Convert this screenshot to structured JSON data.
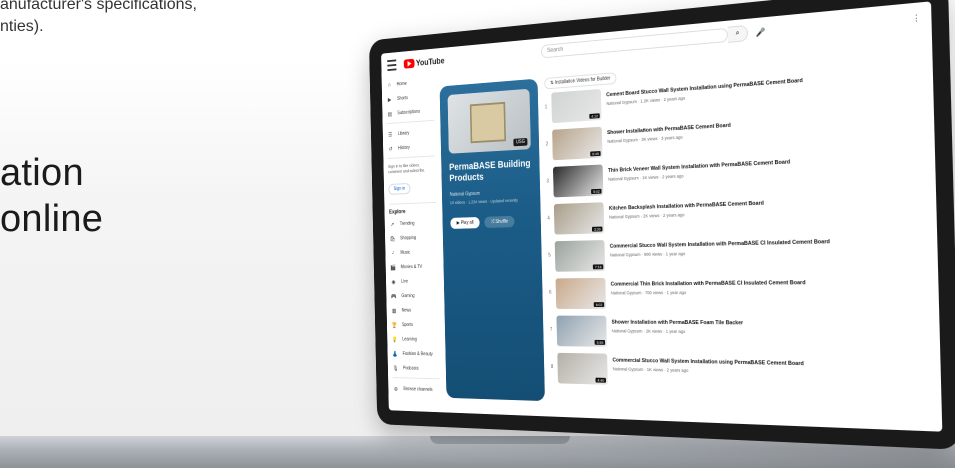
{
  "intro": {
    "line1": "anufacturer's specifications,",
    "line2": "nties)."
  },
  "headline": {
    "line1": "ation",
    "line2": "online"
  },
  "youtube": {
    "logo_text": "YouTube",
    "search_placeholder": "Search",
    "sidebar": {
      "items": [
        {
          "icon": "⌂",
          "label": "Home"
        },
        {
          "icon": "▶",
          "label": "Shorts"
        },
        {
          "icon": "▤",
          "label": "Subscriptions"
        },
        {
          "icon": "☰",
          "label": "Library"
        },
        {
          "icon": "↺",
          "label": "History"
        }
      ],
      "note": "Sign in to like videos, comment and subscribe.",
      "sign_in": "Sign in",
      "explore_title": "Explore",
      "explore_items": [
        {
          "icon": "↗",
          "label": "Trending"
        },
        {
          "icon": "🛍",
          "label": "Shopping"
        },
        {
          "icon": "♪",
          "label": "Music"
        },
        {
          "icon": "🎬",
          "label": "Movies & TV"
        },
        {
          "icon": "◉",
          "label": "Live"
        },
        {
          "icon": "🎮",
          "label": "Gaming"
        },
        {
          "icon": "▦",
          "label": "News"
        },
        {
          "icon": "🏆",
          "label": "Sports"
        },
        {
          "icon": "💡",
          "label": "Learning"
        },
        {
          "icon": "👗",
          "label": "Fashion & Beauty"
        },
        {
          "icon": "🎙",
          "label": "Podcasts"
        }
      ],
      "browse": "Browse channels"
    },
    "playlist": {
      "title": "PermaBASE Building Products",
      "owner": "National Gypsum",
      "meta": "10 videos · 1,234 views · Updated recently",
      "thumb_badge": "USG",
      "play_all": "▶ Play all",
      "shuffle": "⤮ Shuffle"
    },
    "filter_label": "⇅ Installation Videos for Builder",
    "videos": [
      {
        "num": "1",
        "title": "Cement Board Stucco Wall System Installation using PermaBASE Cement Board",
        "meta": "National Gypsum · 1.2K views · 2 years ago",
        "thumb": "#cfd4d2",
        "dur": "4:12"
      },
      {
        "num": "2",
        "title": "Shower Installation with PermaBASE Cement Board",
        "meta": "National Gypsum · 3K views · 3 years ago",
        "thumb": "#b7a48a",
        "dur": "6:45"
      },
      {
        "num": "3",
        "title": "Thin Brick Veneer Wall System Installation with PermaBASE Cement Board",
        "meta": "National Gypsum · 1K views · 2 years ago",
        "thumb": "#2a2a2a",
        "dur": "5:02"
      },
      {
        "num": "4",
        "title": "Kitchen Backsplash Installation with PermaBASE Cement Board",
        "meta": "National Gypsum · 2K views · 2 years ago",
        "thumb": "#a89d88",
        "dur": "3:30"
      },
      {
        "num": "5",
        "title": "Commercial Stucco Wall System Installation with PermaBASE CI Insulated Cement Board",
        "meta": "National Gypsum · 900 views · 1 year ago",
        "thumb": "#9aa39c",
        "dur": "7:18"
      },
      {
        "num": "6",
        "title": "Commercial Thin Brick Installation with PermaBASE CI Insulated Cement Board",
        "meta": "National Gypsum · 700 views · 1 year ago",
        "thumb": "#c9a98a",
        "dur": "6:02"
      },
      {
        "num": "7",
        "title": "Shower Installation with PermaBASE Foam Tile Backer",
        "meta": "National Gypsum · 2K views · 1 year ago",
        "thumb": "#8fa2b0",
        "dur": "5:55"
      },
      {
        "num": "8",
        "title": "Commercial Stucco Wall System Installation using PermaBASE Cement Board",
        "meta": "National Gypsum · 1K views · 2 years ago",
        "thumb": "#b4b0a6",
        "dur": "4:40"
      }
    ]
  }
}
